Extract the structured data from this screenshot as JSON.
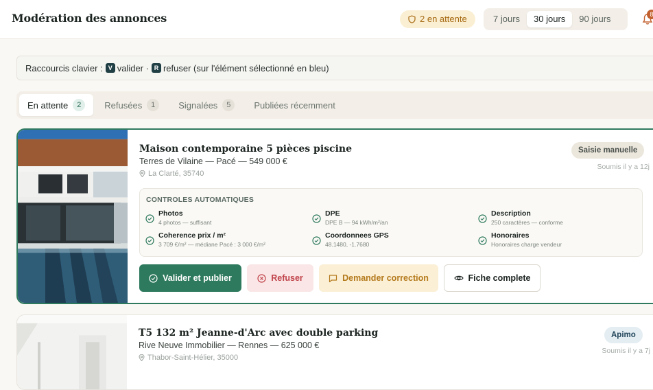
{
  "header": {
    "title": "Modération des annonces",
    "pending_label": "2 en attente",
    "periods": [
      {
        "label": "7 jours",
        "active": false
      },
      {
        "label": "30 jours",
        "active": true
      },
      {
        "label": "90 jours",
        "active": false
      }
    ],
    "notifications_count": "8"
  },
  "shortcuts": {
    "prefix": "Raccourcis clavier :",
    "key_validate": "V",
    "validate_label": "valider ·",
    "key_reject": "R",
    "reject_label": "refuser (sur l'élément sélectionné en bleu)"
  },
  "tabs": [
    {
      "label": "En attente",
      "count": "2",
      "active": true
    },
    {
      "label": "Refusées",
      "count": "1",
      "active": false
    },
    {
      "label": "Signalées",
      "count": "5",
      "active": false
    },
    {
      "label": "Publiées récemment",
      "count": "",
      "active": false
    }
  ],
  "listings": [
    {
      "title": "Maison contemporaine 5 pièces piscine",
      "subtitle": "Terres de Vilaine — Pacé — 549 000 €",
      "location": "La Clarté, 35740",
      "source": "Saisie manuelle",
      "submitted": "Soumis il y a 12j",
      "checks_title": "CONTROLES AUTOMATIQUES",
      "checks": [
        {
          "label": "Photos",
          "detail": "4 photos — suffisant"
        },
        {
          "label": "DPE",
          "detail": "DPE B — 94 kWh/m²/an"
        },
        {
          "label": "Description",
          "detail": "250 caractères — conforme"
        },
        {
          "label": "Coherence prix / m²",
          "detail": "3 709 €/m² — médiane Pacé : 3 000 €/m²"
        },
        {
          "label": "Coordonnees GPS",
          "detail": "48.1480, -1.7680"
        },
        {
          "label": "Honoraires",
          "detail": "Honoraires charge vendeur"
        }
      ],
      "actions": {
        "approve": "Valider et publier",
        "reject": "Refuser",
        "correction": "Demander correction",
        "full": "Fiche complete"
      }
    },
    {
      "title": "T5 132 m² Jeanne-d'Arc avec double parking",
      "subtitle": "Rive Neuve Immobilier — Rennes — 625 000 €",
      "location": "Thabor-Saint-Hélier, 35000",
      "source": "Apimo",
      "submitted": "Soumis il y a 7j"
    }
  ],
  "colors": {
    "accent": "#2e7a5e",
    "pending": "#a66a12",
    "danger": "#c0434b",
    "warning": "#b47a1b"
  }
}
